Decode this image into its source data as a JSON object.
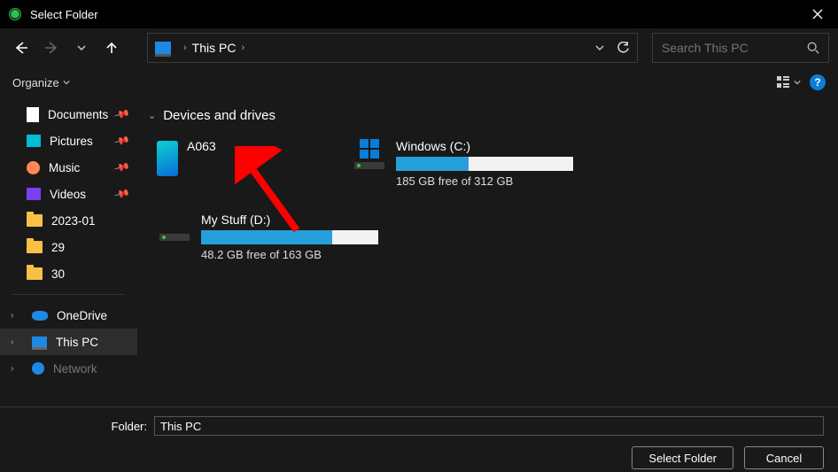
{
  "window": {
    "title": "Select Folder"
  },
  "nav": {
    "address_location": "This PC",
    "refresh": "⟳"
  },
  "search": {
    "placeholder": "Search This PC"
  },
  "toolbar": {
    "organize": "Organize"
  },
  "sidebar": {
    "quick": [
      {
        "label": "Documents",
        "icon": "doc",
        "pinned": true
      },
      {
        "label": "Pictures",
        "icon": "pic",
        "pinned": true
      },
      {
        "label": "Music",
        "icon": "music",
        "pinned": true
      },
      {
        "label": "Videos",
        "icon": "video",
        "pinned": true
      },
      {
        "label": "2023-01",
        "icon": "folder",
        "pinned": false
      },
      {
        "label": "29",
        "icon": "folder",
        "pinned": false
      },
      {
        "label": "30",
        "icon": "folder",
        "pinned": false
      }
    ],
    "nav": [
      {
        "label": "OneDrive",
        "icon": "cloud",
        "selected": false
      },
      {
        "label": "This PC",
        "icon": "pc",
        "selected": true
      },
      {
        "label": "Network",
        "icon": "net",
        "selected": false,
        "cut": true
      }
    ]
  },
  "content": {
    "group_header": "Devices and drives",
    "devices": [
      {
        "kind": "phone",
        "name": "A063"
      },
      {
        "kind": "drive",
        "name": "Windows (C:)",
        "has_winlogo": true,
        "fill_pct": 41,
        "free_text": "185 GB free of 312 GB"
      },
      {
        "kind": "drive",
        "name": "My Stuff (D:)",
        "has_winlogo": false,
        "fill_pct": 74,
        "free_text": "48.2 GB free of 163 GB"
      }
    ]
  },
  "footer": {
    "folder_label": "Folder:",
    "folder_value": "This PC",
    "select_btn": "Select Folder",
    "cancel_btn": "Cancel"
  }
}
